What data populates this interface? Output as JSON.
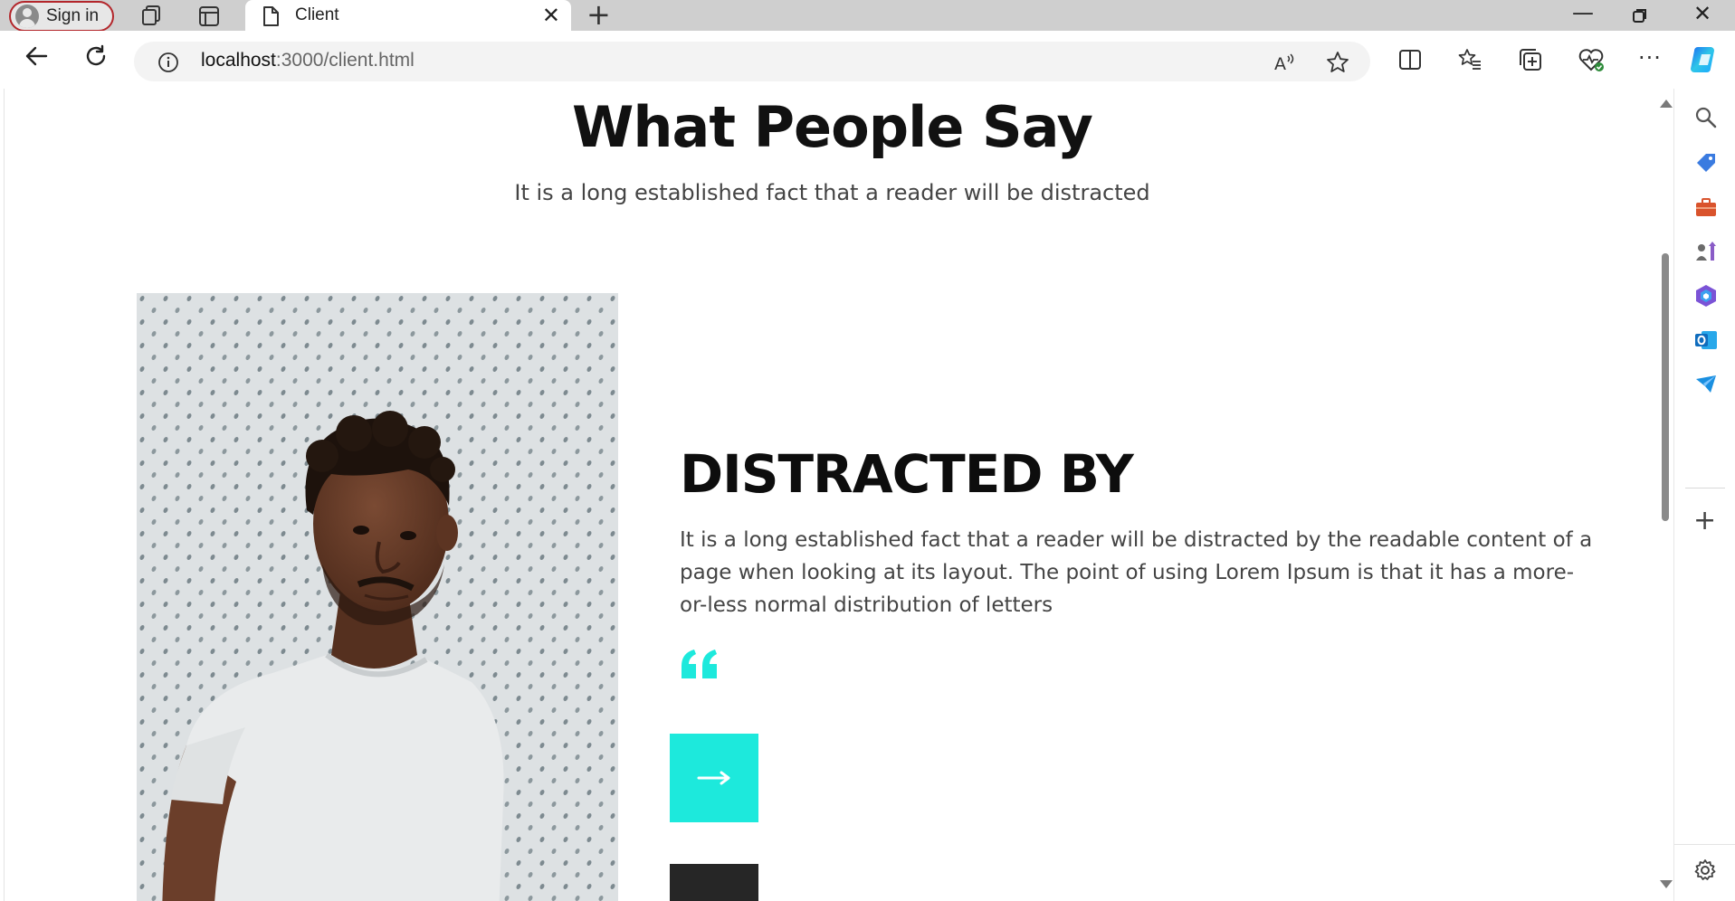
{
  "browser": {
    "signin_label": "Sign in",
    "tab_title": "Client",
    "url_host": "localhost",
    "url_path": ":3000/client.html"
  },
  "page": {
    "heading": "What People Say",
    "subheading": "It is a long established fact that a reader will be distracted",
    "testimonial": {
      "title": "DISTRACTED BY",
      "text": "It is a long established fact that a reader will be distracted by the readable content of a page when looking at its layout. The point of using Lorem Ipsum is that it has a more-or-less normal distribution of letters",
      "next_arrow": "⟶"
    }
  },
  "colors": {
    "accent": "#1de9dc",
    "dark_button": "#262626",
    "heading": "#111111",
    "body_text": "#444444",
    "signin_border": "#b3262b"
  }
}
